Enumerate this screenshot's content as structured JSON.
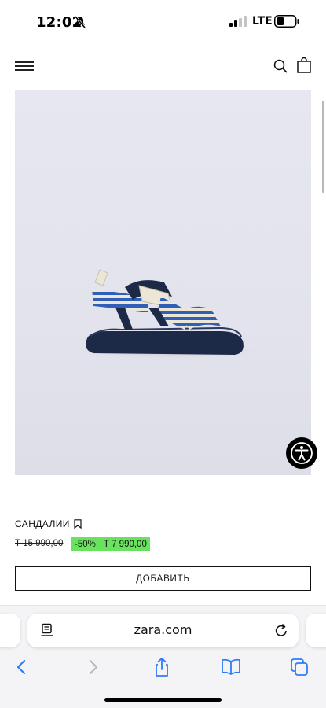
{
  "status_bar": {
    "time": "12:02",
    "network": "LTE",
    "icons": [
      "bell-slash-icon",
      "signal-bars-icon",
      "battery-icon"
    ]
  },
  "header": {
    "icons": [
      "hamburger-menu-icon",
      "search-icon",
      "shopping-bag-icon"
    ]
  },
  "product": {
    "name": "САНДАЛИИ",
    "original_price": "Т 15 990,00",
    "discount": "-50%",
    "sale_price": "Т 7 990,00",
    "add_button_label": "ДОБАВИТЬ",
    "image_icon": "sandal-photo",
    "accessibility_icon": "accessibility-person-icon",
    "colors": {
      "sale_tag": "#69e25d",
      "sandal_navy": "#1c2947",
      "stripe_blue": "#2f5fb8"
    }
  },
  "browser": {
    "url": "zara.com",
    "icons": [
      "reader-mode-icon",
      "reload-icon",
      "back-icon",
      "forward-icon",
      "share-icon",
      "bookmarks-icon",
      "tabs-icon"
    ],
    "accent": "#2f7cf6"
  }
}
